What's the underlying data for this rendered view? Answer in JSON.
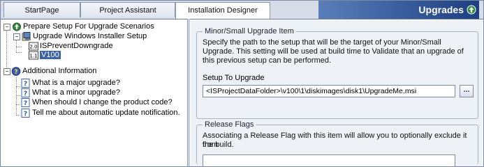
{
  "tabs": [
    {
      "label": "StartPage",
      "active": false
    },
    {
      "label": "Project Assistant",
      "active": false
    },
    {
      "label": "Installation Designer",
      "active": true
    }
  ],
  "header": {
    "title": "Upgrades",
    "title_icon": "upgrade-arrow-icon"
  },
  "tree": {
    "root_label": "Prepare Setup For Upgrade Scenarios",
    "upgrade_windows_label": "Upgrade Windows Installer Setup",
    "prevent_downgrade_label": "ISPreventDowngrade",
    "v100_label": "V100",
    "additional_label": "Additional Information",
    "help_items": [
      "What is a major upgrade?",
      "What is a minor upgrade?",
      "When should I change the product code?",
      "Tell me about automatic update notification."
    ]
  },
  "minor_group": {
    "legend": "Minor/Small Upgrade Item",
    "description_lines": [
      "Specify the path to the setup that will be the target of your Minor/Small",
      "Upgrade.  This setting will be used at build time to Validate that an upgrade of",
      "this previous setup can be performed."
    ],
    "setup_label": "Setup To Upgrade",
    "setup_value": "<ISProjectDataFolder>\\v100\\1\\diskimages\\disk1\\UpgradeMe.msi",
    "browse_label": "..."
  },
  "release_group": {
    "legend": "Release Flags",
    "description_lines": [
      "Associating a Release Flag with this item will allow you to optionally exclude it from",
      "the build."
    ],
    "value": ""
  },
  "colors": {
    "header_gradient_start": "#5a7fb8",
    "header_gradient_end": "#1d3f83",
    "selection": "#3c63a8"
  }
}
